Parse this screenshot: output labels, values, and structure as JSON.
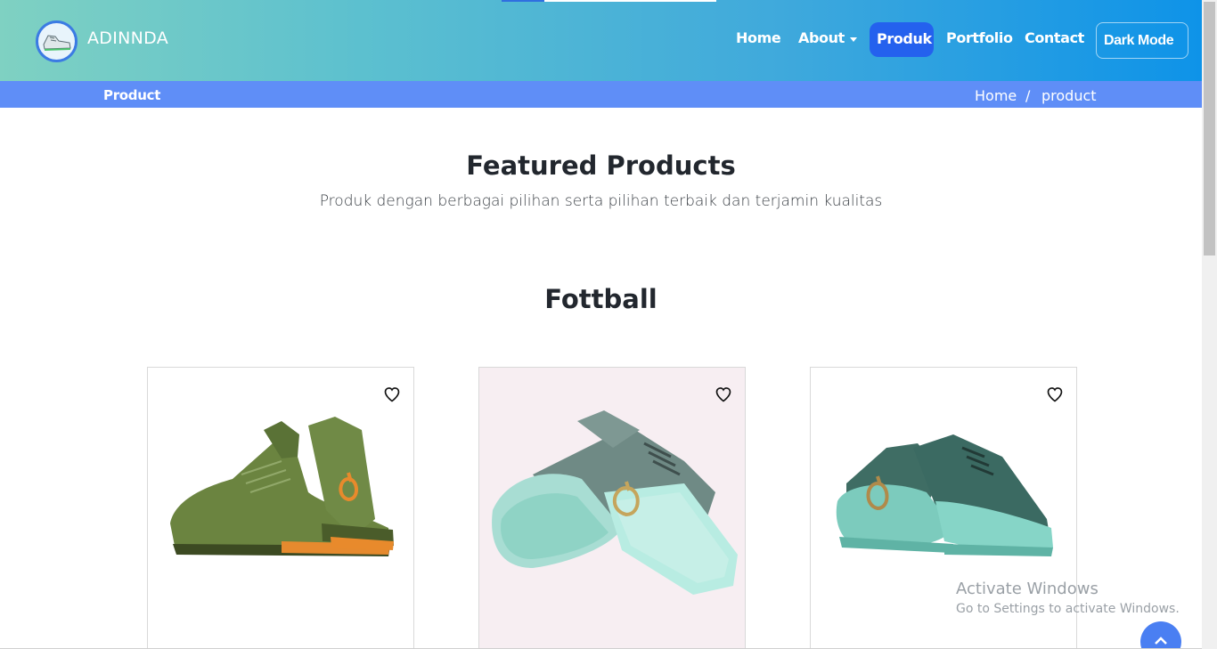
{
  "header": {
    "brand": "ADINNDA",
    "nav": {
      "home": "Home",
      "about": "About",
      "produk": "Produk",
      "portfolio": "Portfolio",
      "contact": "Contact",
      "dark_mode": "Dark Mode"
    },
    "active_item": "Produk",
    "accent_color": "#2461ee"
  },
  "breadcrumb": {
    "title": "Product",
    "home": "Home",
    "separator": "/",
    "current": "product"
  },
  "featured": {
    "title": "Featured Products",
    "subtitle": "Produk dengan berbagai pilihan serta pilihan terbaik dan terjamin kualitas"
  },
  "category": {
    "title": "Fottball"
  },
  "products": [
    {
      "shoe_color": "olive-green with orange sole",
      "favorite_icon": "heart-outline-icon"
    },
    {
      "shoe_color": "grey-green with mint sole",
      "favorite_icon": "heart-outline-icon"
    },
    {
      "shoe_color": "dark-teal with mint sole",
      "favorite_icon": "heart-outline-icon"
    }
  ],
  "watermark": {
    "title": "Activate Windows",
    "subtitle": "Go to Settings to activate Windows."
  },
  "back_to_top_icon": "chevron-up-icon"
}
